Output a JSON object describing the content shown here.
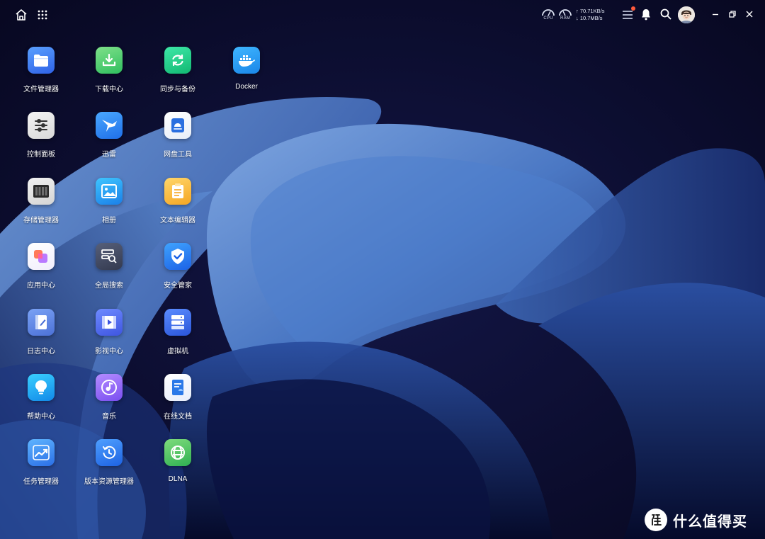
{
  "topbar": {
    "home_icon": "home-icon",
    "apps_icon": "grid-icon",
    "cpu_label": "CPU",
    "ram_label": "RAM",
    "upload_speed": "↑ 70.71KB/s",
    "download_speed": "↓ 10.7MB/s",
    "task_icon": "task-list-icon",
    "bell_icon": "bell-icon",
    "search_icon": "search-icon",
    "minimize_icon": "minimize-icon",
    "restore_icon": "restore-icon",
    "close_icon": "close-icon"
  },
  "apps": [
    {
      "label": "文件管理器",
      "icon": "folder-icon"
    },
    {
      "label": "下载中心",
      "icon": "download-icon"
    },
    {
      "label": "同步与备份",
      "icon": "sync-icon"
    },
    {
      "label": "Docker",
      "icon": "docker-icon"
    },
    {
      "label": "控制面板",
      "icon": "sliders-icon"
    },
    {
      "label": "迅雷",
      "icon": "bird-icon"
    },
    {
      "label": "网盘工具",
      "icon": "cloud-drive-icon"
    },
    {
      "label": "存储管理器",
      "icon": "storage-icon"
    },
    {
      "label": "相册",
      "icon": "photo-icon"
    },
    {
      "label": "文本编辑器",
      "icon": "notepad-icon"
    },
    {
      "label": "应用中心",
      "icon": "app-store-icon"
    },
    {
      "label": "全局搜索",
      "icon": "global-search-icon"
    },
    {
      "label": "安全管家",
      "icon": "shield-icon"
    },
    {
      "label": "日志中心",
      "icon": "log-icon"
    },
    {
      "label": "影视中心",
      "icon": "video-icon"
    },
    {
      "label": "虚拟机",
      "icon": "server-icon"
    },
    {
      "label": "帮助中心",
      "icon": "bulb-icon"
    },
    {
      "label": "音乐",
      "icon": "music-icon"
    },
    {
      "label": "在线文档",
      "icon": "document-icon"
    },
    {
      "label": "任务管理器",
      "icon": "chart-icon"
    },
    {
      "label": "版本资源管理器",
      "icon": "history-icon"
    },
    {
      "label": "DLNA",
      "icon": "dlna-icon"
    }
  ],
  "watermark": {
    "text": "什么值得买",
    "logo_text": "值"
  }
}
